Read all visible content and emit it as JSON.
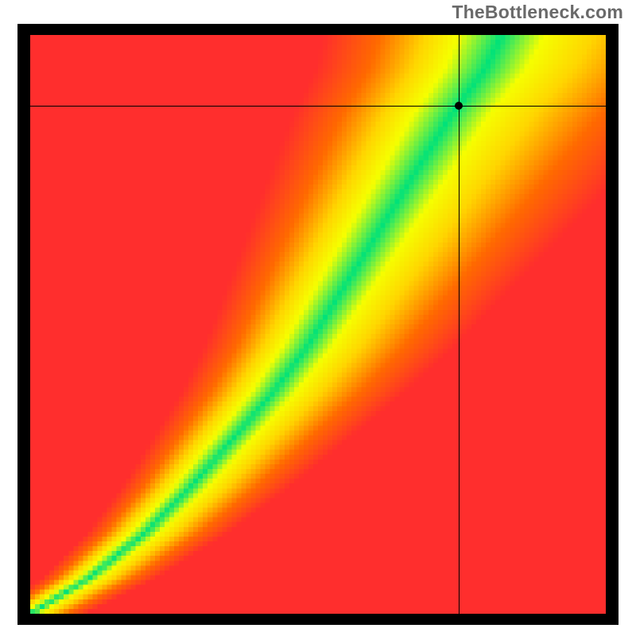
{
  "watermark_text": "TheBottleneck.com",
  "chart_data": {
    "type": "heatmap",
    "title": "",
    "xlabel": "",
    "ylabel": "",
    "xlim": [
      0,
      1
    ],
    "ylim": [
      0,
      1
    ],
    "grid": false,
    "legend": false,
    "crosshair": {
      "x": 0.745,
      "y": 0.878
    },
    "marker": {
      "x": 0.745,
      "y": 0.878
    },
    "colorscale": {
      "low": "#ff1a3c",
      "mid_low": "#ff6a00",
      "mid": "#ffd600",
      "mid_high": "#f6ff00",
      "high": "#00e27a"
    },
    "ridge_points": [
      {
        "x": 0.0,
        "y": 0.0
      },
      {
        "x": 0.1,
        "y": 0.06
      },
      {
        "x": 0.2,
        "y": 0.14
      },
      {
        "x": 0.28,
        "y": 0.22
      },
      {
        "x": 0.35,
        "y": 0.3
      },
      {
        "x": 0.42,
        "y": 0.38
      },
      {
        "x": 0.48,
        "y": 0.46
      },
      {
        "x": 0.53,
        "y": 0.54
      },
      {
        "x": 0.58,
        "y": 0.62
      },
      {
        "x": 0.63,
        "y": 0.7
      },
      {
        "x": 0.68,
        "y": 0.78
      },
      {
        "x": 0.73,
        "y": 0.86
      },
      {
        "x": 0.79,
        "y": 0.94
      },
      {
        "x": 0.82,
        "y": 1.0
      }
    ],
    "pixel_resolution": {
      "nx": 120,
      "ny": 120
    }
  }
}
